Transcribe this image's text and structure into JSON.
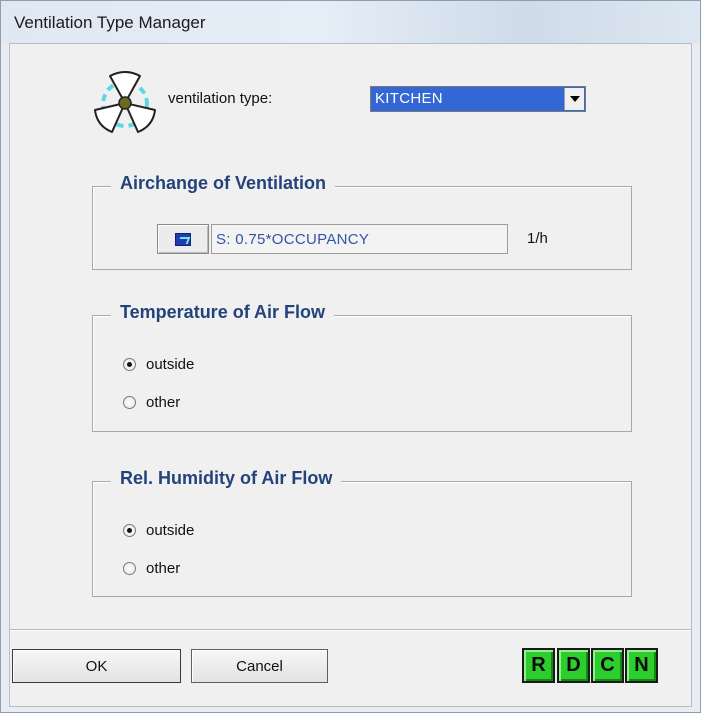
{
  "window": {
    "title": "Ventilation Type Manager"
  },
  "header": {
    "icon": "fan-icon",
    "type_label": "ventilation type:",
    "type_value": "KITCHEN"
  },
  "airchange": {
    "title": "Airchange of Ventilation",
    "value": "S: 0.75*OCCUPANCY",
    "unit": "1/h"
  },
  "temperature": {
    "title": "Temperature of Air Flow",
    "options": [
      {
        "label": "outside",
        "checked": true
      },
      {
        "label": "other",
        "checked": false
      }
    ]
  },
  "humidity": {
    "title": "Rel. Humidity of Air Flow",
    "options": [
      {
        "label": "outside",
        "checked": true
      },
      {
        "label": "other",
        "checked": false
      }
    ]
  },
  "footer": {
    "ok_label": "OK",
    "cancel_label": "Cancel",
    "tool_buttons": [
      "R",
      "D",
      "C",
      "N"
    ]
  },
  "colors": {
    "group_title": "#23437a",
    "combo_selected_bg": "#3367d6",
    "tool_button_green": "#2ccd2c"
  }
}
